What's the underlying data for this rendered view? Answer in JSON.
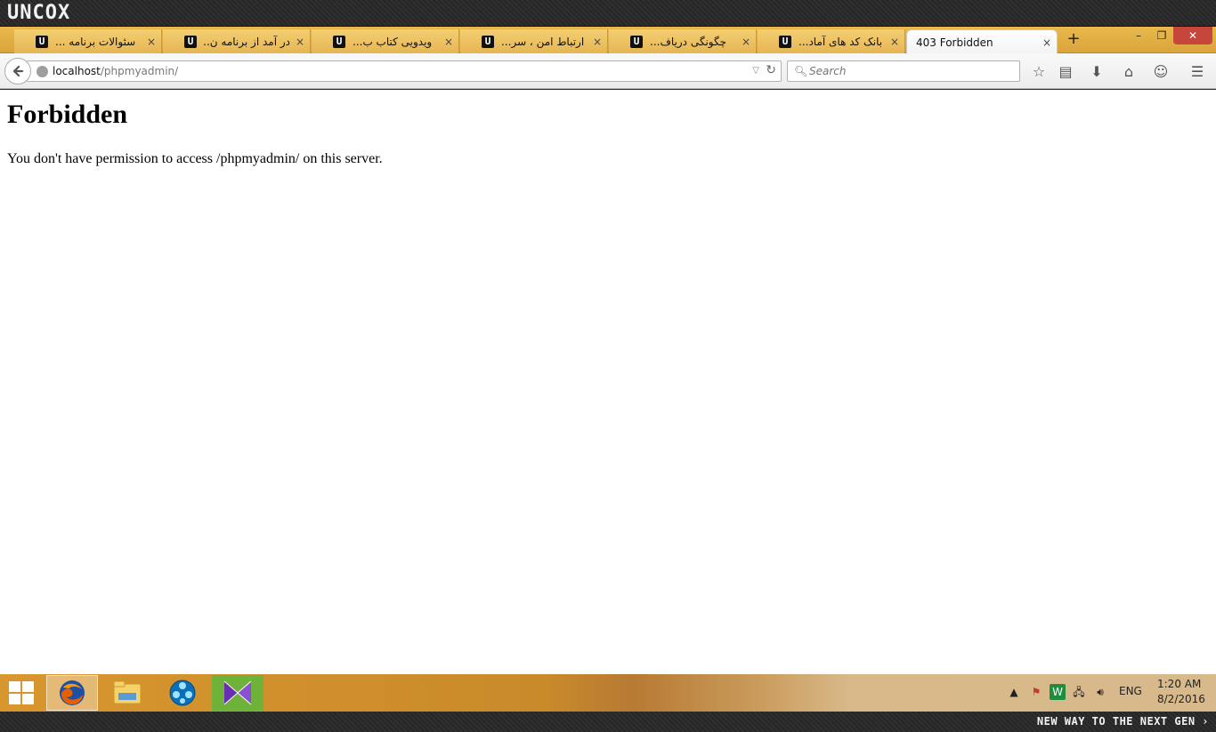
{
  "brand": {
    "logo_text": "UNCOX"
  },
  "tabs": [
    {
      "title": "سئوالات برنامه ...",
      "favicon": "U",
      "active": false
    },
    {
      "title": "در آمد از برنامه ن...",
      "favicon": "U",
      "active": false
    },
    {
      "title": "ویدویی کتاب ب...",
      "favicon": "U",
      "active": false
    },
    {
      "title": "ارتباط امن ، سر...",
      "favicon": "U",
      "active": false
    },
    {
      "title": "چگونگی دریاف...",
      "favicon": "U",
      "active": false
    },
    {
      "title": "بانک کد های آماد...",
      "favicon": "U",
      "active": false
    },
    {
      "title": "403 Forbidden",
      "favicon": "",
      "active": true
    }
  ],
  "tab_close_glyph": "×",
  "new_tab_glyph": "+",
  "window_controls": {
    "minimize": "–",
    "maximize": "❐",
    "close": "✕"
  },
  "address_bar": {
    "host": "localhost",
    "path": "/phpmyadmin/"
  },
  "search": {
    "placeholder": "Search"
  },
  "toolbar_icons": [
    "star-icon",
    "reading-list-icon",
    "download-icon",
    "home-icon",
    "smiley-icon",
    "menu-icon"
  ],
  "page": {
    "heading": "Forbidden",
    "message": "You don't have permission to access /phpmyadmin/ on this server."
  },
  "taskbar": {
    "apps": [
      "firefox-icon",
      "file-explorer-icon",
      "media-player-icon",
      "visual-studio-icon"
    ],
    "language": "ENG",
    "time": "1:20 AM",
    "date": "8/2/2016"
  },
  "footer": {
    "tagline": "NEW WAY TO THE NEXT GEN ›"
  },
  "colors": {
    "tabstrip": "#e0ad45",
    "close_button": "#c7463b",
    "taskbar": "#d8962e"
  }
}
